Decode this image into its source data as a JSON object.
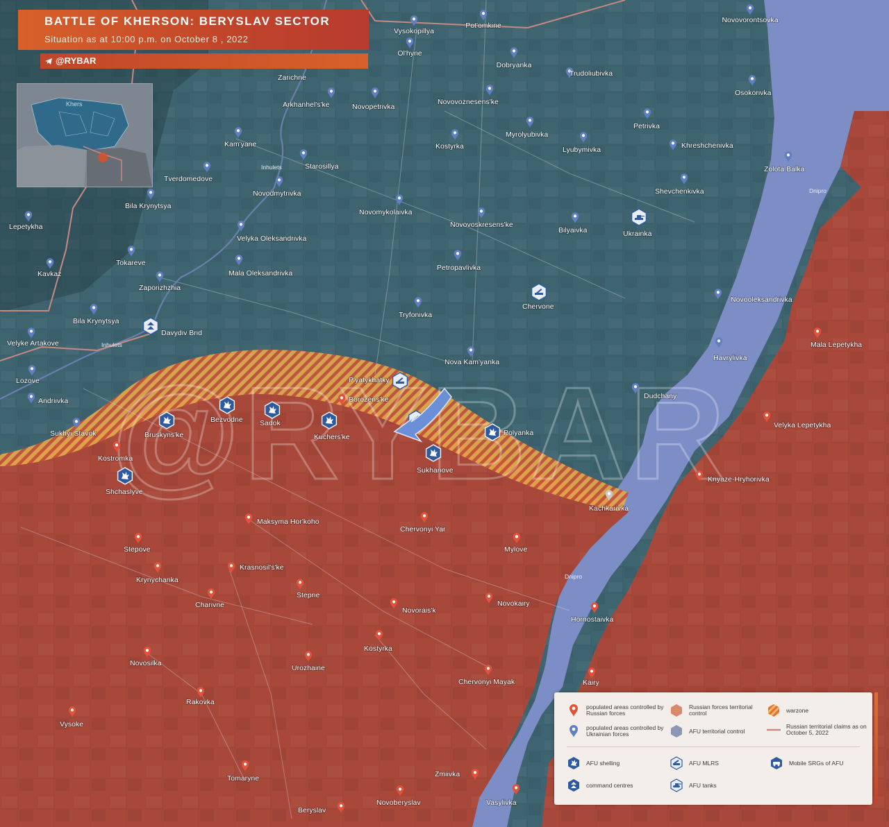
{
  "header": {
    "title": "BATTLE OF KHERSON: BERYSLAV SECTOR",
    "subtitle": "Situation as at 10:00 p.m. on October 8 , 2022",
    "brand": "@RYBAR"
  },
  "watermark": "@RYBAR",
  "inset": {
    "label": "Khers"
  },
  "rivers": [
    "Inhulets",
    "Inhulets",
    "Dnipro",
    "Dnipro"
  ],
  "colors": {
    "russian_territory": "#a8483a",
    "afu_territory": "#3e6470",
    "warzone": "#e0a23a",
    "river": "#7d8ec6",
    "claims_line": "#c88a80"
  },
  "places_ukrainian": [
    "Vysokopillya",
    "Pot'omkine",
    "Novovorontsovka",
    "Ol'hyne",
    "Dobryanka",
    "Trudoliubivka",
    "Zarichne",
    "Arkhanhel's'ke",
    "Novopetrivka",
    "Novovoznesens'ke",
    "Osokorivka",
    "Petrivka",
    "Myrolyubivka",
    "Kostyrka",
    "Lyubymivka",
    "Khreshchenivka",
    "Kam'yane",
    "Starosillya",
    "Zolota Balka",
    "Tverdomedove",
    "Novodmytrivka",
    "Shevchenkivka",
    "Bila Krynytsya",
    "Novomykolaivka",
    "Novovoskresens'ke",
    "Bilyaivka",
    "Lepetykha",
    "Velyka Oleksandrivka",
    "Tokareve",
    "Kavkaz",
    "Petropavlivka",
    "Mala Oleksandrivka",
    "Zaporizhzhia",
    "Tryfonivka",
    "Novooleksandrivka",
    "Bila Krynytsya",
    "Velyke Artakove",
    "Havrylivka",
    "Nova Kam'yanka",
    "Lozove",
    "Dudchany",
    "Andriivka",
    "Sukhyi Stavok"
  ],
  "places_contested": [
    "Kachkarivka"
  ],
  "places_russian": [
    "Borozens'ke",
    "Kostromka",
    "Mala Lepetykha",
    "Velyka Lepetykha",
    "Knyaze-Hryhorivka",
    "Maksyma Hor'koho",
    "Chervonyi Yar",
    "Stepove",
    "Mylove",
    "Krasnosil's'ke",
    "Krynychanka",
    "Stepne",
    "Charivne",
    "Novokairy",
    "Novorais'k",
    "Hornostaivka",
    "Kostyrka",
    "Novosilka",
    "Urozhaine",
    "Chervonyi Mayak",
    "Kairy",
    "Rakovka",
    "Vysoke",
    "Zmiivka",
    "Tomaryne",
    "Novoberyslav",
    "Beryslav",
    "Vasylivka"
  ],
  "afu_shelling": [
    "Bezvodne",
    "Sadok",
    "Bruskyns'ke",
    "Kuchers'ke",
    "Polyanka",
    "Sukhanove",
    "Shchaslyve"
  ],
  "afu_mlrs": [
    "P'yatykhatky",
    "Chervone"
  ],
  "afu_tanks": [
    "Ukrainka"
  ],
  "command_centres": [
    "Davydiv Brid"
  ],
  "legend": [
    {
      "symbol": "russian-pin",
      "label": "populated areas controlled by Russian forces"
    },
    {
      "symbol": "russian-hex",
      "label": "Russian forces territorial control"
    },
    {
      "symbol": "warzone-hatch",
      "label": "warzone"
    },
    {
      "symbol": "ukrainian-pin",
      "label": "populated areas controlled by Ukrainian forces"
    },
    {
      "symbol": "afu-hex",
      "label": "AFU territorial control"
    },
    {
      "symbol": "claims-line",
      "label": "Russian territorial claims as on October 5, 2022"
    },
    {
      "symbol": "shelling-icon",
      "label": "AFU shelling"
    },
    {
      "symbol": "mlrs-icon",
      "label": "AFU MLRS"
    },
    {
      "symbol": "srg-icon",
      "label": "Mobile SRGs of AFU"
    },
    {
      "symbol": "command-icon",
      "label": "command centres"
    },
    {
      "symbol": "tank-icon",
      "label": "AFU tanks"
    }
  ]
}
